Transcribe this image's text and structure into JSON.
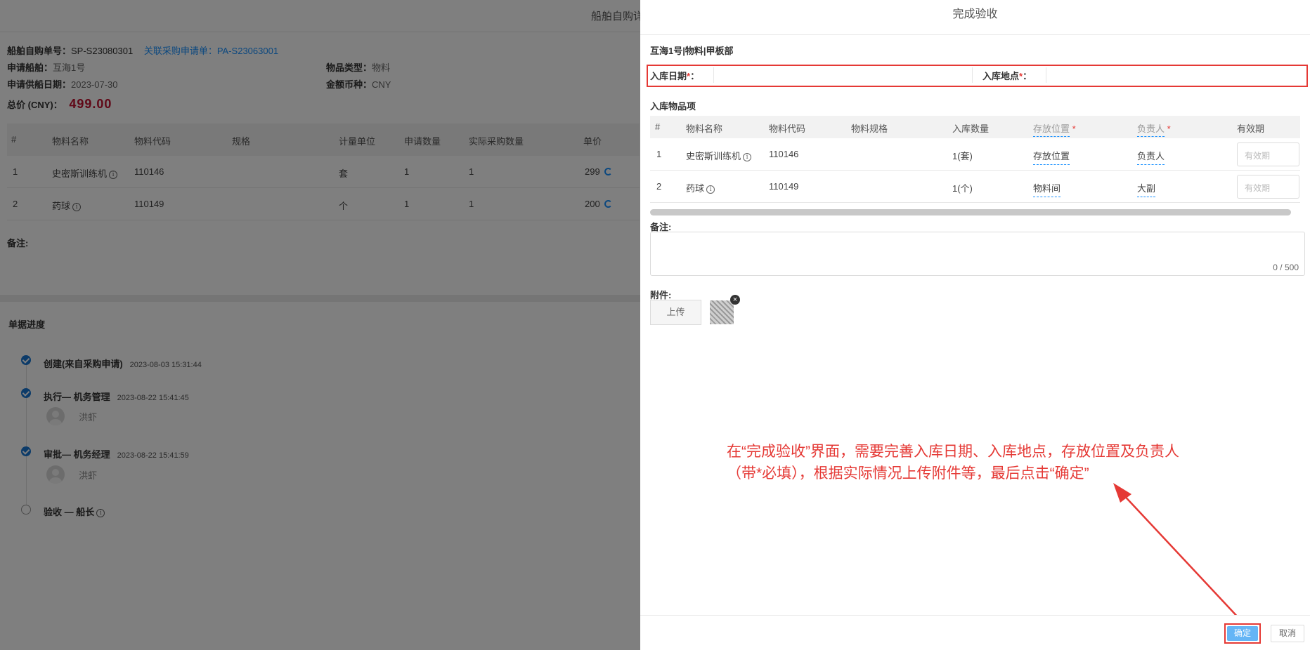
{
  "background": {
    "page_title": "船舶自购详",
    "order_no_label": "船舶自购单号：",
    "order_no": "SP-S23080301",
    "linked_label": "关联采购申请单：",
    "linked_no": "PA-S23063001",
    "ship_label": "申请船舶：",
    "ship": "互海1号",
    "goods_type_label": "物品类型：",
    "goods_type": "物料",
    "supply_date_label": "申请供船日期：",
    "supply_date": "2023-07-30",
    "currency_label": "金额币种：",
    "currency": "CNY",
    "total_label": "总价 (CNY)：",
    "total": "499.00",
    "table": {
      "headers": [
        "#",
        "物料名称",
        "物料代码",
        "规格",
        "计量单位",
        "申请数量",
        "实际采购数量",
        "单价"
      ],
      "rows": [
        [
          "1",
          "史密斯训练机",
          "110146",
          "",
          "套",
          "1",
          "1",
          "299"
        ],
        [
          "2",
          "药球",
          "110149",
          "",
          "个",
          "1",
          "1",
          "200"
        ]
      ]
    },
    "remark_label": "备注:",
    "progress_title": "单据进度",
    "timeline": [
      {
        "title": "创建(来自采购申请)",
        "time": "2023-08-03 15:31:44",
        "user": ""
      },
      {
        "title": "执行— 机务管理",
        "time": "2023-08-22 15:41:45",
        "user": "洪虾"
      },
      {
        "title": "审批— 机务经理",
        "time": "2023-08-22 15:41:59",
        "user": "洪虾"
      },
      {
        "title": "验收 — 船长",
        "time": "",
        "user": ""
      }
    ]
  },
  "drawer": {
    "title": "完成验收",
    "subtitle": "互海1号|物料|甲板部",
    "date_label": "入库日期",
    "place_label": "入库地点",
    "required_mark": "*",
    "colon": "：",
    "items_title": "入库物品项",
    "headers": [
      "#",
      "物料名称",
      "物料代码",
      "物料规格",
      "入库数量",
      "存放位置",
      "负责人",
      "有效期"
    ],
    "rows": [
      {
        "no": "1",
        "name": "史密斯训练机",
        "code": "110146",
        "spec": "",
        "qty": "1(套)",
        "location": "存放位置",
        "owner": "负责人",
        "expiry": "有效期"
      },
      {
        "no": "2",
        "name": "药球",
        "code": "110149",
        "spec": "",
        "qty": "1(个)",
        "location": "物料间",
        "owner": "大副",
        "expiry": "有效期"
      }
    ],
    "remark_label": "备注:",
    "remark_counter": "0 / 500",
    "attach_label": "附件:",
    "upload_label": "上传",
    "ok_label": "确定",
    "cancel_label": "取消"
  },
  "annotation": {
    "line1": "在“完成验收”界面，需要完善入库日期、入库地点，存放位置及负责人",
    "line2": "（带*必填），根据实际情况上传附件等，最后点击“确定”",
    "color": "#e53935"
  }
}
